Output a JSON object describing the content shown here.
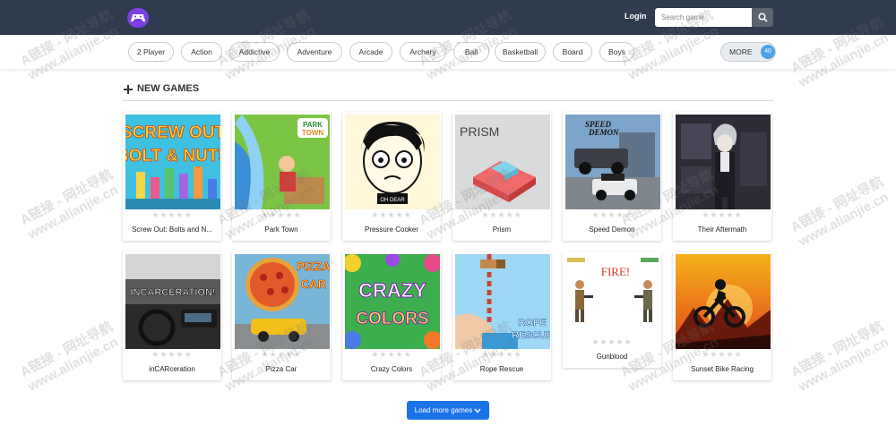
{
  "header": {
    "logo_icon": "gamepad-icon",
    "login_label": "Login",
    "search_placeholder": "Search game",
    "search_icon": "search-icon"
  },
  "categories": [
    "2 Player",
    "Action",
    "Addictive",
    "Adventure",
    "Arcade",
    "Archery",
    "Ball",
    "Basketball",
    "Board",
    "Boys"
  ],
  "more": {
    "label": "MORE",
    "count": "40"
  },
  "section": {
    "title": "NEW GAMES",
    "icon": "plus-icon"
  },
  "games": [
    {
      "title": "Screw Out: Bolts and N..."
    },
    {
      "title": "Park Town"
    },
    {
      "title": "Pressure Cooker"
    },
    {
      "title": "Prism"
    },
    {
      "title": "Speed Demon"
    },
    {
      "title": "Their Aftermath"
    },
    {
      "title": "inCARceration"
    },
    {
      "title": "Pizza Car"
    },
    {
      "title": "Crazy Colors"
    },
    {
      "title": "Rope Rescue"
    },
    {
      "title": "Gunblood"
    },
    {
      "title": "Sunset Bike Racing"
    }
  ],
  "thumb_text": {
    "screw_line1": "SCREW OUT",
    "screw_line2": "BOLT & NUTS",
    "park_line1": "PARK",
    "park_line2": "TOWN",
    "pressure_caption": "OH DEAR",
    "prism": "PRISM",
    "speed_line1": "SPEED",
    "speed_line2": "DEMON",
    "incar": "INCARCERATION!",
    "pizza_line1": "PIZZA",
    "pizza_line2": "CAR",
    "crazy_line1": "CRAZY",
    "crazy_line2": "COLORS",
    "rope_line1": "ROPE",
    "rope_line2": "RESCUE",
    "gunblood": "FIRE!"
  },
  "stars": "★★★★★",
  "load_more": {
    "label": "Load more games",
    "icon": "chevron-down-icon"
  },
  "watermark": {
    "line1": "A链接 - 网址导航",
    "line2": "www.alianjie.cn"
  },
  "colors": {
    "header_bg": "#2f3b4e",
    "accent": "#1a73e8",
    "logo": "#7b3fe4",
    "badge": "#4da3e6"
  }
}
